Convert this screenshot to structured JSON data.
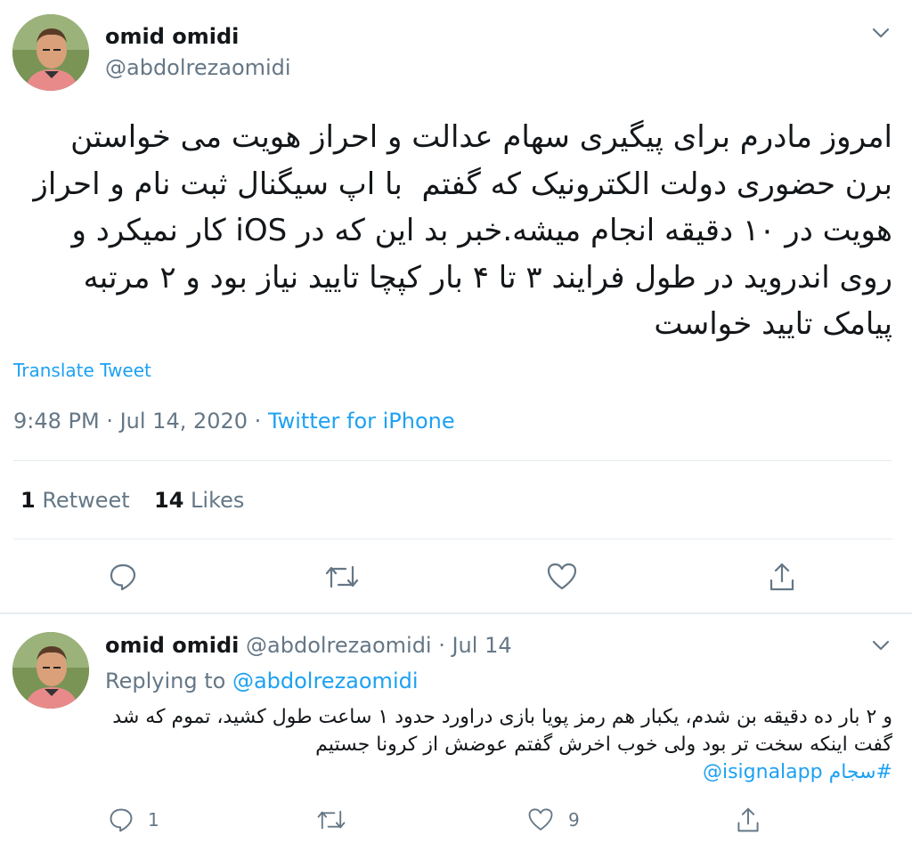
{
  "tweet": {
    "author_name": "omid omidi",
    "author_handle": "@abdolrezaomidi",
    "text_lines_before": "امروز مادرم برای پیگیری سهام عدالت و احراز هویت می خواستن برن حضوری دولت الکترونیک که گفتم  با اپ سیگنال ثبت نام و احراز هویت در ۱۰ دقیقه انجام میشه.خبر بد این که در ",
    "text_ios": "iOS",
    "text_after": " کار نمیکرد و روی اندروید در طول فرایند ۳ تا ۴ بار کپچا تایید نیاز بود و ۲ مرتبه پیامک تایید خواست",
    "translate_label": "Translate Tweet",
    "timestamp": "9:48 PM · Jul 14, 2020 · ",
    "source": "Twitter for iPhone",
    "retweet_count": "1",
    "retweet_label": " Retweet",
    "likes_count": "14",
    "likes_label": " Likes"
  },
  "reply": {
    "author_name": "omid omidi",
    "author_handle_date": " @abdolrezaomidi · Jul 14",
    "replying_prefix": "Replying to ",
    "replying_to": "@abdolrezaomidi",
    "text": "و ۲ بار ده دقیقه بن شدم، یکبار هم رمز پویا بازی دراورد حدود ۱ ساعت طول کشید، تموم که شد گفت اینکه سخت تر بود ولی خوب اخرش گفتم عوضش از کرونا جستیم",
    "hashtag": "#سجام",
    "mention": "@isignalapp",
    "reply_count": "1",
    "like_count": "9"
  },
  "icons": {
    "menu": "chevron-down-icon",
    "reply": "reply-icon",
    "retweet": "retweet-icon",
    "like": "heart-icon",
    "share": "share-icon"
  },
  "colors": {
    "accent": "#1da1f2",
    "secondary_text": "#657786",
    "divider": "#e6ecf0"
  }
}
